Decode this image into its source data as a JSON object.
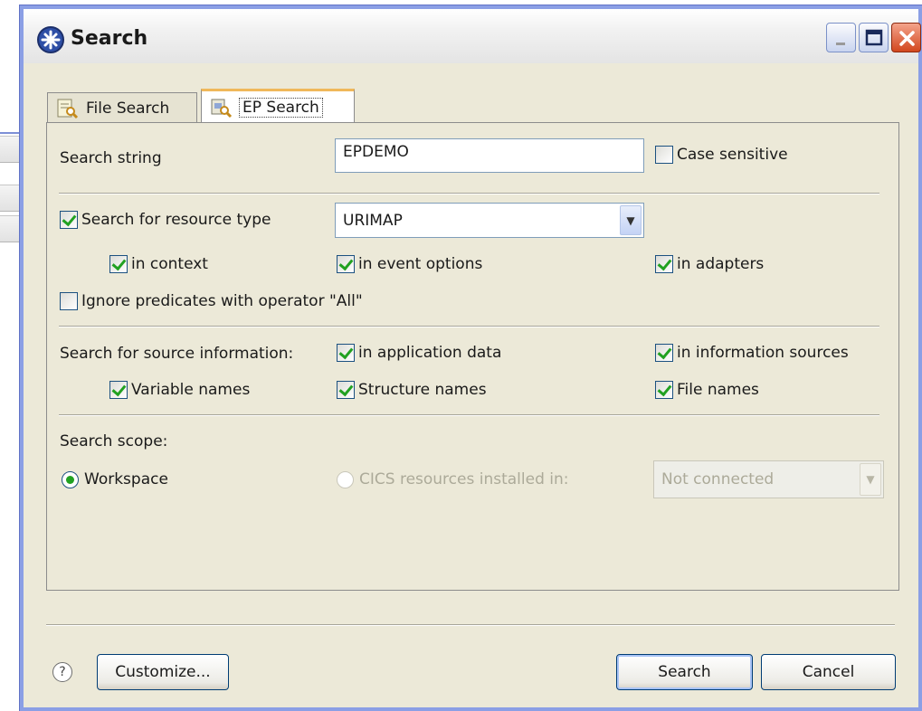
{
  "window": {
    "title": "Search"
  },
  "tabs": [
    {
      "label": "File Search",
      "active": false
    },
    {
      "label": "EP Search",
      "active": true
    }
  ],
  "search_string": {
    "label": "Search string",
    "value": "EPDEMO"
  },
  "case_sensitive": {
    "label": "Case sensitive",
    "checked": false
  },
  "resource_type": {
    "checkbox_label": "Search for resource type",
    "checked": true,
    "selected": "URIMAP",
    "in_context": "in context",
    "in_event_options": "in event options",
    "in_adapters": "in adapters"
  },
  "ignore_predicates": {
    "label": "Ignore predicates with operator \"All\"",
    "checked": false
  },
  "source_info": {
    "label": "Search for source information:",
    "in_application_data": "in application data",
    "in_information_sources": "in information sources",
    "variable_names": "Variable names",
    "structure_names": "Structure names",
    "file_names": "File names"
  },
  "scope": {
    "label": "Search scope:",
    "workspace": "Workspace",
    "cics": "CICS resources installed in:",
    "connection": "Not connected"
  },
  "buttons": {
    "help": "?",
    "customize": "Customize...",
    "search": "Search",
    "cancel": "Cancel"
  },
  "colors": {
    "accent": "#21a121",
    "frame": "#8b9fe5",
    "close": "#d2471e"
  }
}
